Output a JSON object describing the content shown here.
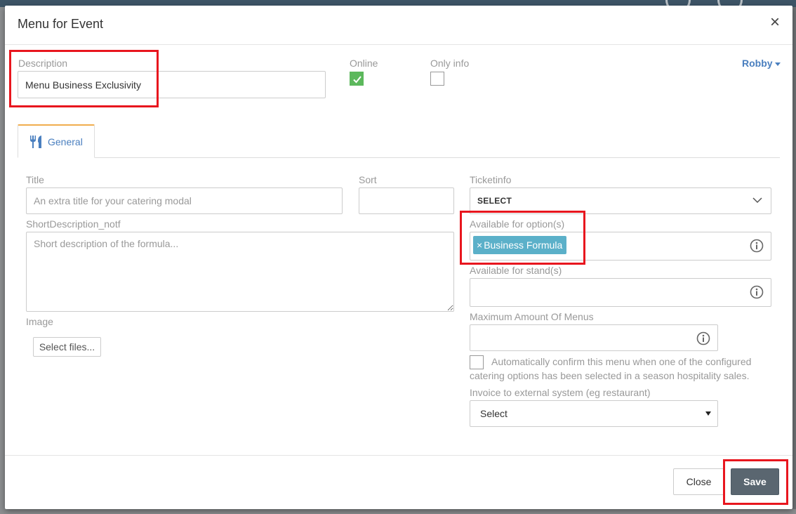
{
  "modal": {
    "title": "Menu for Event",
    "close_glyph": "×",
    "user_menu": "Robby"
  },
  "header_fields": {
    "description_label": "Description",
    "description_value": "Menu Business Exclusivity",
    "online_label": "Online",
    "online_checked": true,
    "only_info_label": "Only info",
    "only_info_checked": false
  },
  "tabs": [
    {
      "label": "General",
      "icon": "cutlery-icon",
      "active": true
    }
  ],
  "form": {
    "title_label": "Title",
    "title_placeholder": "An extra title for your catering modal",
    "sort_label": "Sort",
    "sort_value": "",
    "short_desc_label": "ShortDescription_notf",
    "short_desc_placeholder": "Short description of the formula...",
    "image_label": "Image",
    "select_files_label": "Select files...",
    "ticketinfo_label": "Ticketinfo",
    "ticketinfo_value": "SELECT",
    "options_label": "Available for option(s)",
    "options_tags": [
      "Business Formula"
    ],
    "tag_remove_glyph": "×",
    "stands_label": "Available for stand(s)",
    "max_menus_label": "Maximum Amount Of Menus",
    "max_menus_value": "",
    "auto_confirm_checked": false,
    "auto_confirm_text": "Automatically confirm this menu when one of the configured catering options has been selected in a season hospitality sales.",
    "invoice_label": "Invoice to external system (eg restaurant)",
    "invoice_value": "Select"
  },
  "footer": {
    "close_label": "Close",
    "save_label": "Save"
  },
  "colors": {
    "accent": "#4a7fbf",
    "checkbox_checked": "#5cb85c",
    "tag_bg": "#5bb0c9",
    "save_bg": "#5a6670",
    "highlight": "#e8161e"
  }
}
